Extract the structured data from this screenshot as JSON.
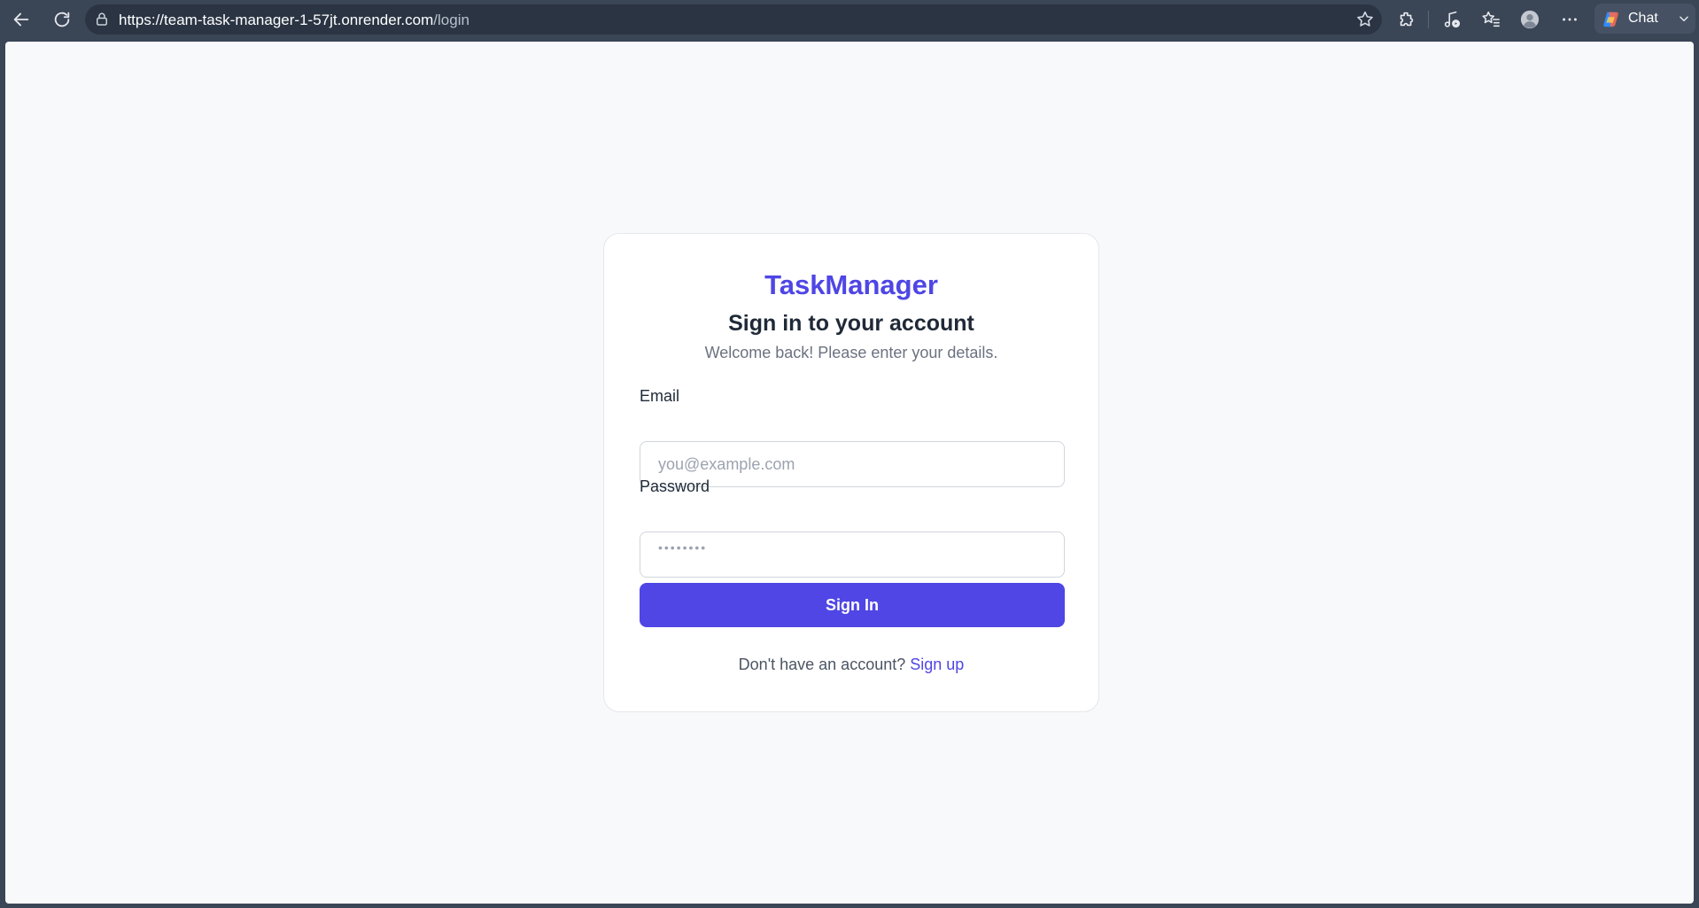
{
  "browser": {
    "url_host": "https://team-task-manager-1-57jt.onrender.com",
    "url_path": "/login",
    "chat_label": "Chat",
    "icons": [
      "back-icon",
      "refresh-icon",
      "site-info-icon",
      "favorite-star-icon",
      "extensions-icon",
      "media-icon",
      "favorites-icon",
      "profile-icon",
      "more-icon",
      "copilot-icon",
      "chevron-down-icon"
    ]
  },
  "login": {
    "brand": "TaskManager",
    "heading": "Sign in to your account",
    "subtitle": "Welcome back! Please enter your details.",
    "email_label": "Email",
    "email_placeholder": "you@example.com",
    "password_label": "Password",
    "password_placeholder": "••••••••",
    "submit_label": "Sign In",
    "footer_text": "Don't have an account?",
    "signup_link": "Sign up"
  },
  "colors": {
    "accent": "#4f46e5",
    "chrome": "#3a4556",
    "page_bg": "#f8f9fb"
  }
}
